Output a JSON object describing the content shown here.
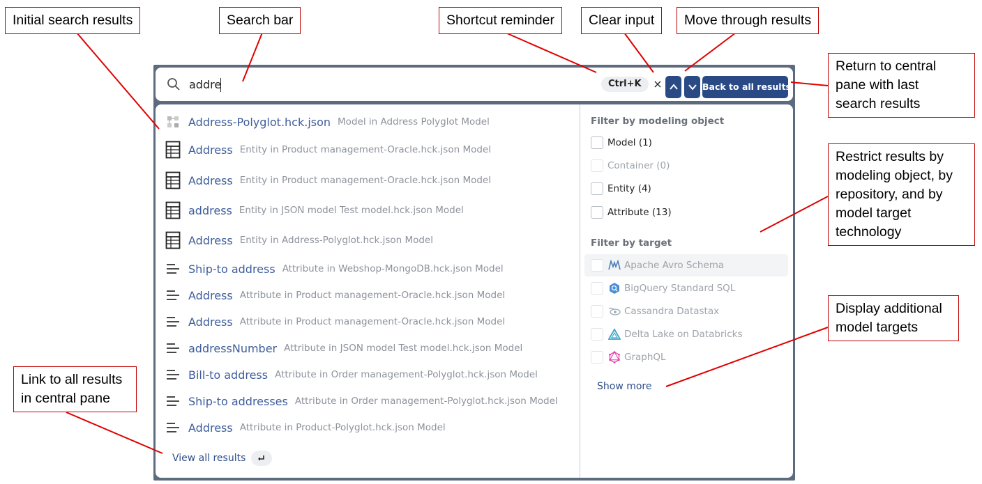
{
  "search": {
    "value": "addre",
    "shortcut": "Ctrl+K",
    "clear": "×",
    "back_label": "Back to all results"
  },
  "results": [
    {
      "icon": "polyglot-model-icon",
      "name": "Address-Polyglot.hck.json",
      "desc": "Model in Address Polyglot Model"
    },
    {
      "icon": "entity-table-icon",
      "name": "Address",
      "desc": "Entity in Product management-Oracle.hck.json Model"
    },
    {
      "icon": "entity-table-icon",
      "name": "Address",
      "desc": "Entity in Product management-Oracle.hck.json Model"
    },
    {
      "icon": "entity-table-icon",
      "name": "address",
      "desc": "Entity in JSON model Test model.hck.json Model"
    },
    {
      "icon": "entity-table-icon",
      "name": "Address",
      "desc": "Entity in Address-Polyglot.hck.json Model"
    },
    {
      "icon": "attribute-lines-icon",
      "name": "Ship-to address",
      "desc": "Attribute in Webshop-MongoDB.hck.json Model"
    },
    {
      "icon": "attribute-lines-icon",
      "name": "Address",
      "desc": "Attribute in Product management-Oracle.hck.json Model"
    },
    {
      "icon": "attribute-lines-icon",
      "name": "Address",
      "desc": "Attribute in Product management-Oracle.hck.json Model"
    },
    {
      "icon": "attribute-lines-icon",
      "name": "addressNumber",
      "desc": "Attribute in JSON model Test model.hck.json Model"
    },
    {
      "icon": "attribute-lines-icon",
      "name": "Bill-to address",
      "desc": "Attribute in Order management-Polyglot.hck.json Model"
    },
    {
      "icon": "attribute-lines-icon",
      "name": "Ship-to addresses",
      "desc": "Attribute in Order management-Polyglot.hck.json Model"
    },
    {
      "icon": "attribute-lines-icon",
      "name": "Address",
      "desc": "Attribute in Product-Polyglot.hck.json Model"
    }
  ],
  "view_all": {
    "label": "View all results",
    "badge_icon": "enter-key-icon"
  },
  "filters": {
    "object_heading": "Filter by modeling object",
    "objects": [
      {
        "label": "Model (1)",
        "disabled": false
      },
      {
        "label": "Container (0)",
        "disabled": true
      },
      {
        "label": "Entity (4)",
        "disabled": false
      },
      {
        "label": "Attribute (13)",
        "disabled": false
      }
    ],
    "target_heading": "Filter by target",
    "targets": [
      {
        "label": "Apache Avro Schema",
        "icon": "avro-icon"
      },
      {
        "label": "BigQuery Standard SQL",
        "icon": "bigquery-icon"
      },
      {
        "label": "Cassandra Datastax",
        "icon": "cassandra-icon"
      },
      {
        "label": "Delta Lake on Databricks",
        "icon": "delta-lake-icon"
      },
      {
        "label": "GraphQL",
        "icon": "graphql-icon"
      }
    ],
    "show_more": "Show more"
  },
  "callouts": {
    "initial_results": "Initial search results",
    "search_bar": "Search bar",
    "shortcut": "Shortcut reminder",
    "clear": "Clear input",
    "move": "Move through results",
    "return_line1": "Return to central",
    "return_line2": "pane with last",
    "return_line3": "search results",
    "restrict_line1": "Restrict results by",
    "restrict_line2": "modeling object, by",
    "restrict_line3": "repository, and by",
    "restrict_line4": "model target",
    "restrict_line5": "technology",
    "display_line1": "Display additional",
    "display_line2": "model targets",
    "link_line1": "Link to all results",
    "link_line2": "in central pane"
  },
  "colors": {
    "accent": "#2a4a86",
    "link": "#3d5d9c",
    "callout_border": "#c00000",
    "frame": "#5d6b7f"
  }
}
